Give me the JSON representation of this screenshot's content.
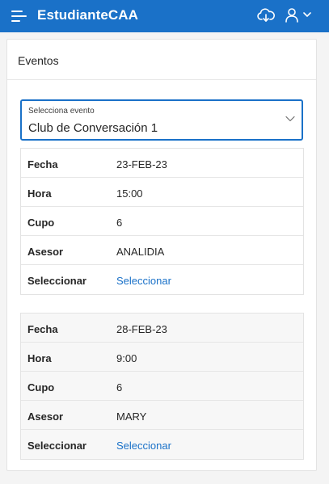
{
  "header": {
    "app_title": "EstudianteCAA",
    "menu_icon": "hamburger-menu-icon",
    "cloud_icon": "cloud-download-icon",
    "user_icon": "user-icon",
    "chevron_icon": "chevron-down-icon",
    "bar_color": "#1a71c8"
  },
  "region": {
    "title": "Eventos"
  },
  "event_select": {
    "label": "Selecciona evento",
    "value": "Club de Conversación 1"
  },
  "events": [
    {
      "fecha_label": "Fecha",
      "fecha": "23-FEB-23",
      "hora_label": "Hora",
      "hora": "15:00",
      "cupo_label": "Cupo",
      "cupo": "6",
      "asesor_label": "Asesor",
      "asesor": "ANALIDIA",
      "seleccionar_label": "Seleccionar",
      "seleccionar_link": "Seleccionar"
    },
    {
      "fecha_label": "Fecha",
      "fecha": "28-FEB-23",
      "hora_label": "Hora",
      "hora": "9:00",
      "cupo_label": "Cupo",
      "cupo": "6",
      "asesor_label": "Asesor",
      "asesor": "MARY",
      "seleccionar_label": "Seleccionar",
      "seleccionar_link": "Seleccionar"
    }
  ],
  "colors": {
    "accent": "#1a71c8",
    "link": "#1a71c8"
  }
}
